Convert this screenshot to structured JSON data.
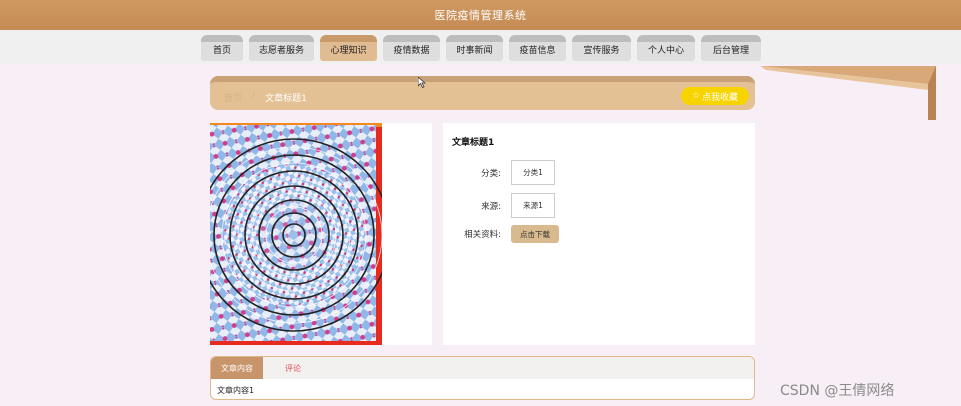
{
  "header": {
    "title": "医院疫情管理系统"
  },
  "nav": {
    "items": [
      {
        "label": "首页"
      },
      {
        "label": "志愿者服务"
      },
      {
        "label": "心理知识"
      },
      {
        "label": "疫情数据"
      },
      {
        "label": "时事新闻"
      },
      {
        "label": "疫苗信息"
      },
      {
        "label": "宣传服务"
      },
      {
        "label": "个人中心"
      },
      {
        "label": "后台管理"
      }
    ],
    "active_index": 2
  },
  "breadcrumb": {
    "home": "首页",
    "separator": "/",
    "current": "文章标题1"
  },
  "favorite_button": {
    "label": "点我收藏",
    "icon": "star-outline-icon"
  },
  "article": {
    "title": "文章标题1",
    "category_label": "分类:",
    "category_value": "分类1",
    "source_label": "来源:",
    "source_value": "来源1",
    "files_label": "相关资料:",
    "download_label": "点击下载"
  },
  "tabs": {
    "items": [
      {
        "label": "文章内容"
      },
      {
        "label": "评论"
      }
    ],
    "active_index": 0,
    "content": "文章内容1"
  },
  "watermark": "CSDN @王倩网络",
  "colors": {
    "header": "#c58b55",
    "nav_active": "#e1bc92",
    "breadcrumb_bg": "#e3c194",
    "favorite": "#f7d400",
    "page_bg": "#f8eff6"
  }
}
